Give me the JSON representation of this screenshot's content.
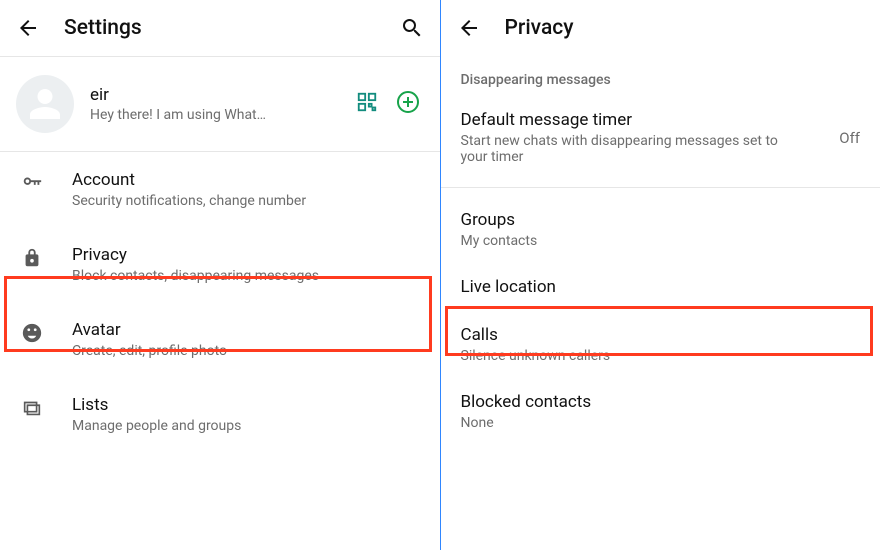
{
  "left": {
    "title": "Settings",
    "profile": {
      "name": "eir",
      "status": "Hey there! I am using What…"
    },
    "items": [
      {
        "title": "Account",
        "sub": "Security notifications, change number"
      },
      {
        "title": "Privacy",
        "sub": "Block contacts, disappearing messages"
      },
      {
        "title": "Avatar",
        "sub": "Create, edit, profile photo"
      },
      {
        "title": "Lists",
        "sub": "Manage people and groups"
      }
    ]
  },
  "right": {
    "title": "Privacy",
    "section": "Disappearing messages",
    "defaultTimer": {
      "title": "Default message timer",
      "sub": "Start new chats with disappearing messages set to your timer",
      "value": "Off"
    },
    "groups": {
      "title": "Groups",
      "sub": "My contacts"
    },
    "live": {
      "title": "Live location"
    },
    "calls": {
      "title": "Calls",
      "sub": "Silence unknown callers"
    },
    "blocked": {
      "title": "Blocked contacts",
      "sub": "None"
    }
  }
}
